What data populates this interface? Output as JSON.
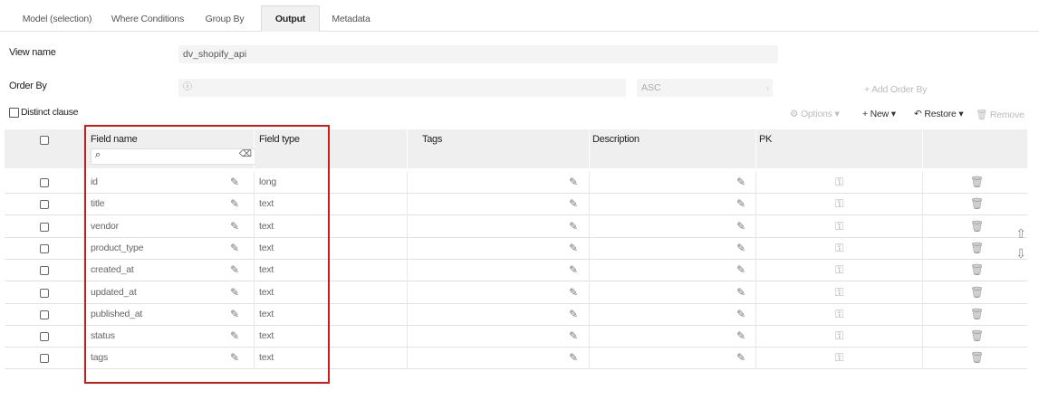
{
  "tabs": [
    {
      "label": "Model (selection)"
    },
    {
      "label": "Where Conditions"
    },
    {
      "label": "Group By"
    },
    {
      "label": "Output"
    },
    {
      "label": "Metadata"
    }
  ],
  "form": {
    "view_name_label": "View name",
    "view_name_value": "dv_shopify_api",
    "order_by_label": "Order By",
    "order_by_direction": "ASC",
    "add_order_by": "+ Add Order By",
    "distinct_label": "Distinct clause"
  },
  "toolbar": {
    "options": "Options",
    "new": "New",
    "restore": "Restore",
    "remove": "Remove"
  },
  "grid": {
    "columns": {
      "field_name": "Field name",
      "field_type": "Field type",
      "tags": "Tags",
      "description": "Description",
      "pk": "PK"
    },
    "rows": [
      {
        "name": "id",
        "type": "long"
      },
      {
        "name": "title",
        "type": "text"
      },
      {
        "name": "vendor",
        "type": "text"
      },
      {
        "name": "product_type",
        "type": "text"
      },
      {
        "name": "created_at",
        "type": "text"
      },
      {
        "name": "updated_at",
        "type": "text"
      },
      {
        "name": "published_at",
        "type": "text"
      },
      {
        "name": "status",
        "type": "text"
      },
      {
        "name": "tags",
        "type": "text"
      }
    ]
  },
  "colors": {
    "accent_highlight": "#d11a1a",
    "header_bg": "#efefef"
  }
}
